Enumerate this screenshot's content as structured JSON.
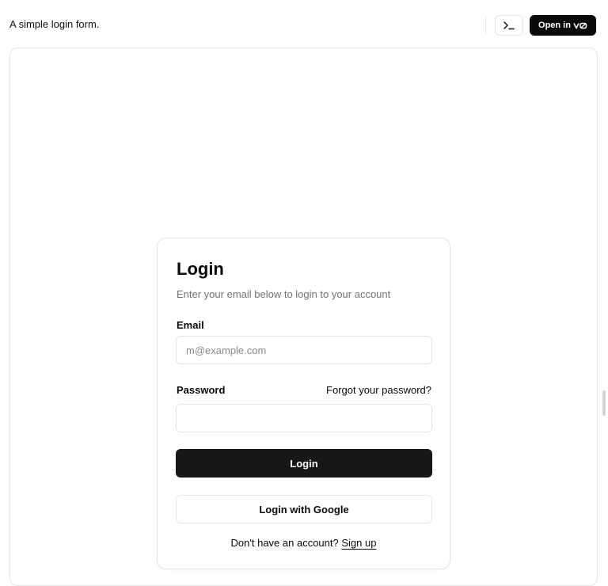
{
  "header": {
    "description": "A simple login form.",
    "terminal_icon": "terminal-icon",
    "open_in_label": "Open in",
    "v0_logo": "v0-logo-icon"
  },
  "card": {
    "title": "Login",
    "description": "Enter your email below to login to your account",
    "email_label": "Email",
    "email_placeholder": "m@example.com",
    "email_value": "",
    "password_label": "Password",
    "password_value": "",
    "forgot_link": "Forgot your password?",
    "login_button": "Login",
    "google_button": "Login with Google",
    "signup_prompt": "Don't have an account?",
    "signup_link": "Sign up"
  },
  "colors": {
    "primary_button_bg": "#171717",
    "border": "#e4e4e7",
    "muted_text": "#737373"
  }
}
